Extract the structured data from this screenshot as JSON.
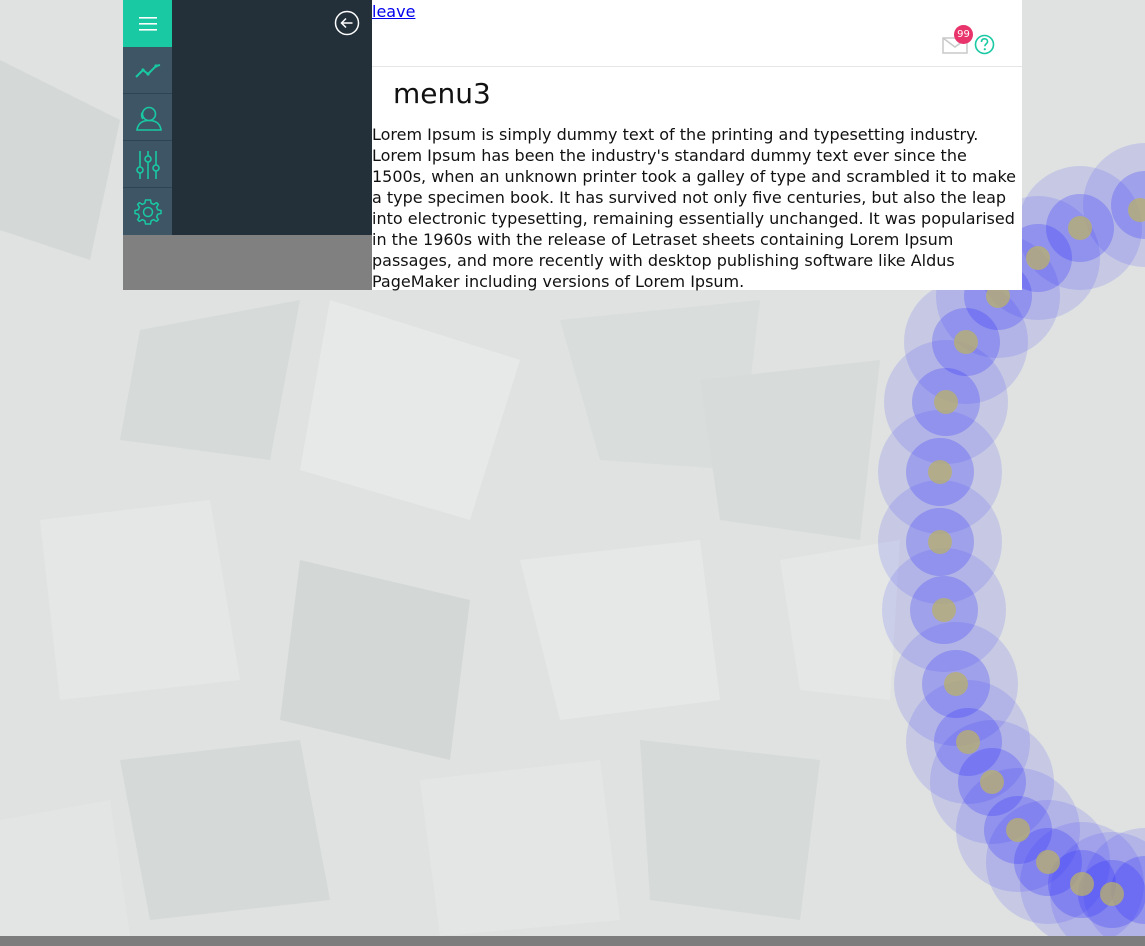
{
  "header": {
    "leave_link": "leave",
    "mail_badge_count": "99",
    "mail_icon": "mail-icon",
    "help_icon": "help-icon"
  },
  "sidebar": {
    "toggle_icon": "hamburger-icon",
    "back_icon": "arrow-left-circle-icon",
    "rail_items": [
      {
        "icon": "trend-chart-icon"
      },
      {
        "icon": "user-icon"
      },
      {
        "icon": "sliders-icon"
      },
      {
        "icon": "gear-icon"
      }
    ]
  },
  "main": {
    "title": "menu3",
    "body": "Lorem Ipsum is simply dummy text of the printing and typesetting industry. Lorem Ipsum has been the industry's standard dummy text ever since the 1500s, when an unknown printer took a galley of type and scrambled it to make a type specimen book. It has survived not only five centuries, but also the leap into electronic typesetting, remaining essentially unchanged. It was popularised in the 1960s with the release of Letraset sheets containing Lorem Ipsum passages, and more recently with desktop publishing software like Aldus PageMaker including versions of Lorem Ipsum."
  },
  "colors": {
    "accent": "#19c9a3",
    "rail": "#3d5565",
    "drawer": "#232f39",
    "badge": "#e8336b",
    "trail": "#2a2aff"
  }
}
